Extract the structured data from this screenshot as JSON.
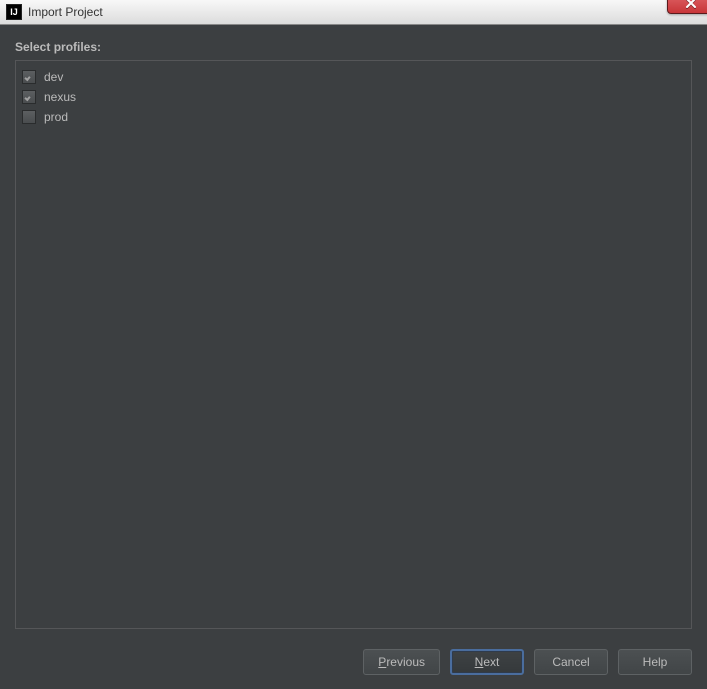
{
  "window": {
    "title": "Import Project"
  },
  "sectionLabel": "Select profiles:",
  "profiles": [
    {
      "label": "dev",
      "checked": true
    },
    {
      "label": "nexus",
      "checked": true
    },
    {
      "label": "prod",
      "checked": false
    }
  ],
  "buttons": {
    "previous": {
      "mnemonic": "P",
      "rest": "revious"
    },
    "next": {
      "mnemonic": "N",
      "rest": "ext"
    },
    "cancel": {
      "label": "Cancel"
    },
    "help": {
      "label": "Help"
    }
  }
}
